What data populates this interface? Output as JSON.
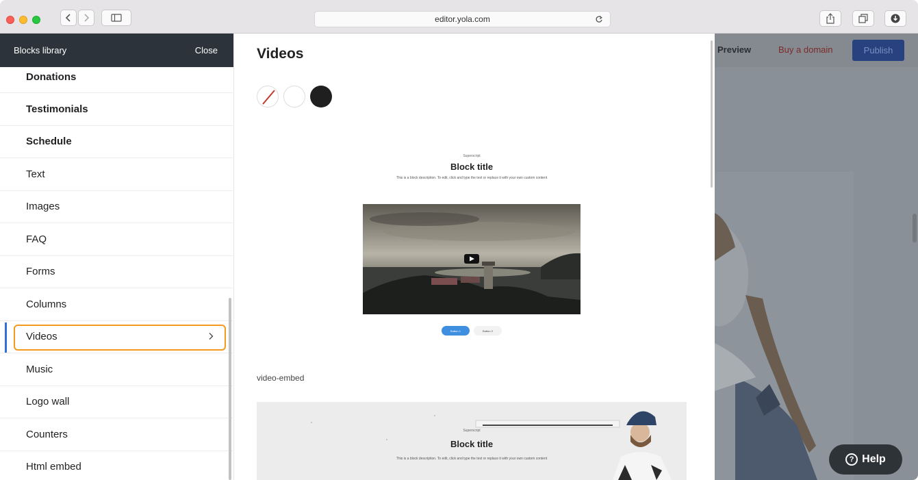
{
  "browser": {
    "url": "editor.yola.com"
  },
  "sidebar": {
    "title": "Blocks library",
    "close_label": "Close",
    "items": [
      {
        "label": "Donations",
        "bold": true
      },
      {
        "label": "Testimonials",
        "bold": true
      },
      {
        "label": "Schedule",
        "bold": true
      },
      {
        "label": "Text",
        "bold": false
      },
      {
        "label": "Images",
        "bold": false
      },
      {
        "label": "FAQ",
        "bold": false
      },
      {
        "label": "Forms",
        "bold": false
      },
      {
        "label": "Columns",
        "bold": false
      },
      {
        "label": "Videos",
        "bold": false,
        "selected": true
      },
      {
        "label": "Music",
        "bold": false
      },
      {
        "label": "Logo wall",
        "bold": false
      },
      {
        "label": "Counters",
        "bold": false
      },
      {
        "label": "Html embed",
        "bold": false
      }
    ],
    "accent_color": "#f39a1e"
  },
  "main": {
    "title": "Videos",
    "color_options": [
      "none",
      "white",
      "dark"
    ],
    "preview1": {
      "superscript": "Superscript",
      "title": "Block title",
      "description": "This is a block description. To edit, click and type the text or replace it with your own custom content",
      "button1": "Button 1",
      "button2": "Button 2"
    },
    "embed_label": "video-embed",
    "preview2": {
      "superscript": "Superscript",
      "title": "Block title",
      "description": "This is a block description. To edit, click and type the text or replace it with your own custom content"
    }
  },
  "editor": {
    "preview_label": "Preview",
    "buy_domain_label": "Buy a domain",
    "publish_label": "Publish",
    "help_label": "Help",
    "publish_color": "#27427f"
  }
}
